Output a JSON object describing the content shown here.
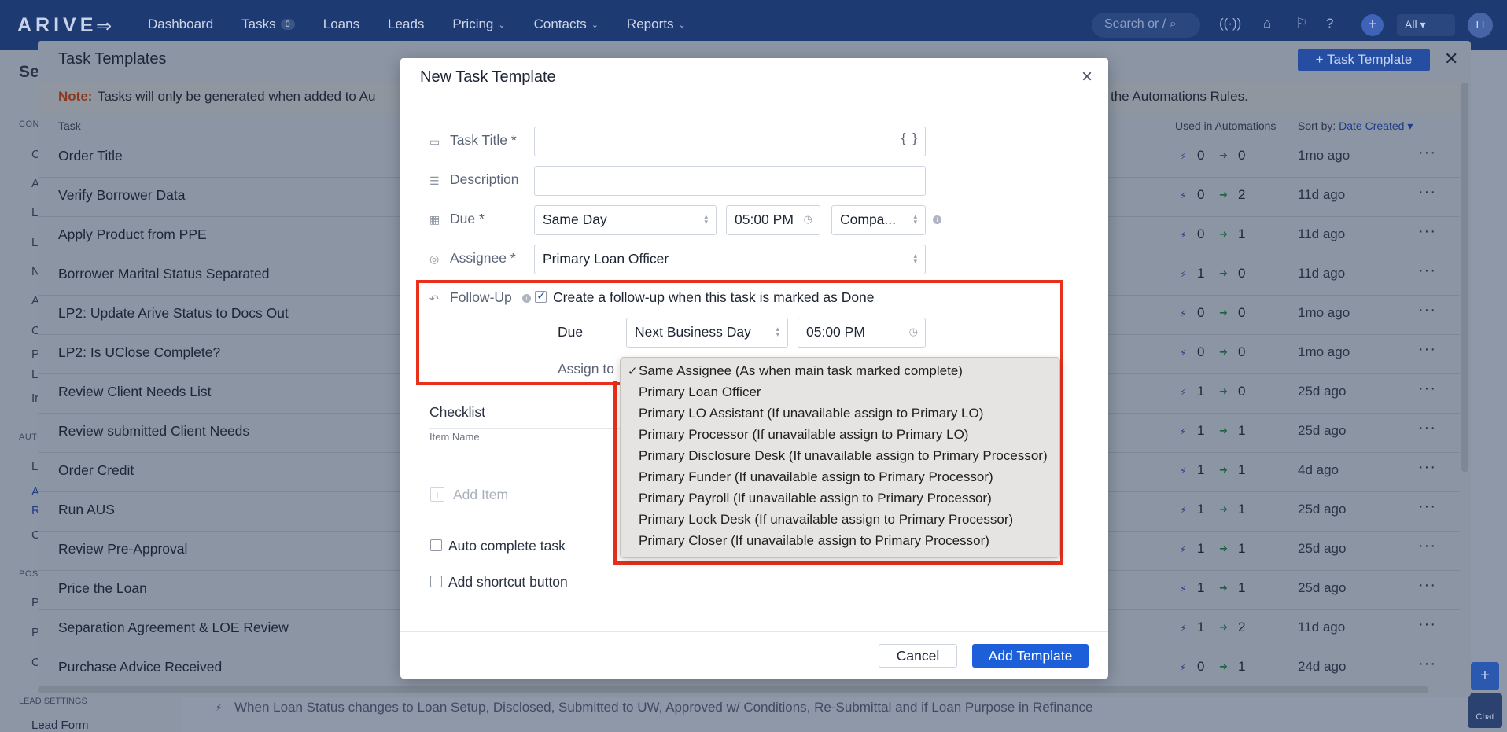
{
  "nav": {
    "logo": "ARIVE",
    "items": [
      "Dashboard",
      "Tasks",
      "Loans",
      "Leads",
      "Pricing",
      "Contacts",
      "Reports"
    ],
    "tasks_badge": "0",
    "search_placeholder": "Search or /",
    "all_label": "All",
    "avatar_initials": "LI"
  },
  "sidebar": {
    "title": "Se",
    "lead_settings": "LEAD SETTINGS",
    "lead_form": "Lead Form"
  },
  "drawer": {
    "title": "Task Templates",
    "add_button": "+ Task Template",
    "note_label": "Note:",
    "note_text": "Tasks will only be generated when added to Au",
    "note_tail": "the Automations Rules.",
    "col_task": "Task",
    "col_used": "Used in Automations",
    "sort_label": "Sort by:",
    "sort_value": "Date Created",
    "rows": [
      {
        "name": "Order Title",
        "a": "0",
        "b": "0",
        "ago": "1mo ago"
      },
      {
        "name": "Verify Borrower Data",
        "a": "0",
        "b": "2",
        "ago": "11d ago"
      },
      {
        "name": "Apply Product from PPE",
        "a": "0",
        "b": "1",
        "ago": "11d ago"
      },
      {
        "name": "Borrower Marital Status Separated",
        "a": "1",
        "b": "0",
        "ago": "11d ago"
      },
      {
        "name": "LP2: Update Arive Status to Docs Out",
        "a": "0",
        "b": "0",
        "ago": "1mo ago"
      },
      {
        "name": "LP2: Is UClose Complete?",
        "a": "0",
        "b": "0",
        "ago": "1mo ago"
      },
      {
        "name": "Review Client Needs List",
        "a": "1",
        "b": "0",
        "ago": "25d ago"
      },
      {
        "name": "Review submitted Client Needs",
        "a": "1",
        "b": "1",
        "ago": "25d ago"
      },
      {
        "name": "Order Credit",
        "a": "1",
        "b": "1",
        "ago": "4d ago"
      },
      {
        "name": "Run AUS",
        "a": "1",
        "b": "1",
        "ago": "25d ago"
      },
      {
        "name": "Review Pre-Approval",
        "a": "1",
        "b": "1",
        "ago": "25d ago"
      },
      {
        "name": "Price the Loan",
        "a": "1",
        "b": "1",
        "ago": "25d ago"
      },
      {
        "name": "Separation Agreement & LOE Review",
        "a": "1",
        "b": "2",
        "ago": "11d ago"
      },
      {
        "name": "Purchase Advice Received",
        "a": "0",
        "b": "1",
        "ago": "24d ago"
      }
    ]
  },
  "bottom_automation": "When Loan Status changes to Loan Setup, Disclosed, Submitted to UW, Approved w/ Conditions, Re-Submittal and if Loan Purpose in Refinance",
  "chat_label": "Chat",
  "modal": {
    "title": "New Task Template",
    "task_title_label": "Task Title",
    "task_title_value": "",
    "description_label": "Description",
    "description_value": "",
    "due_label": "Due",
    "due_value": "Same Day",
    "due_time": "05:00 PM",
    "due_tz": "Compa...",
    "assignee_label": "Assignee",
    "assignee_value": "Primary Loan Officer",
    "followup_label": "Follow-Up",
    "followup_checkbox": "Create a follow-up when this task is marked as Done",
    "followup_due_label": "Due",
    "followup_due_value": "Next Business Day",
    "followup_time": "05:00 PM",
    "assign_to_label": "Assign to",
    "checklist_title": "Checklist",
    "checklist_col": "Item Name",
    "add_item": "Add Item",
    "auto_complete": "Auto complete task",
    "shortcut": "Add shortcut button",
    "cancel": "Cancel",
    "submit": "Add Template"
  },
  "assign_options": [
    "Same Assignee (As when main task marked complete)",
    "Primary Loan Officer",
    "Primary LO Assistant (If unavailable assign to Primary LO)",
    "Primary Processor (If unavailable assign to Primary LO)",
    "Primary Disclosure Desk (If unavailable assign to Primary Processor)",
    "Primary Funder (If unavailable assign to Primary Processor)",
    "Primary Payroll (If unavailable assign to Primary Processor)",
    "Primary Lock Desk (If unavailable assign to Primary Processor)",
    "Primary Closer (If unavailable assign to Primary Processor)"
  ],
  "colors": {
    "nav_bg": "#1e3a73",
    "primary_button": "#1c5fd8",
    "highlight": "#e8301b"
  }
}
